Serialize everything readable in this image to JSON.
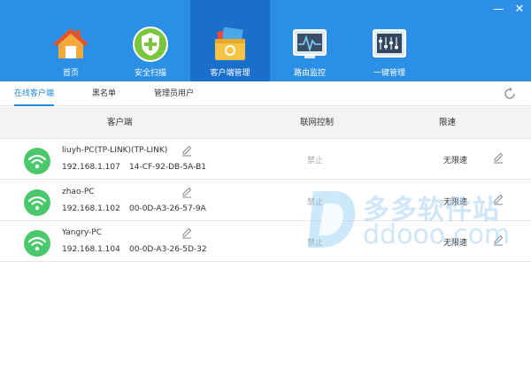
{
  "nav": {
    "items": [
      {
        "label": "首页",
        "icon": "home-icon"
      },
      {
        "label": "安全扫描",
        "icon": "shield-icon"
      },
      {
        "label": "客户端管理",
        "icon": "toolbox-icon"
      },
      {
        "label": "路由监控",
        "icon": "monitor-icon"
      },
      {
        "label": "一键管理",
        "icon": "panel-icon"
      }
    ],
    "active_index": 2
  },
  "window": {
    "minimize_label": "—",
    "close_label": "✕"
  },
  "tabs": [
    {
      "label": "在线客户端",
      "active": true
    },
    {
      "label": "黑名单",
      "active": false
    },
    {
      "label": "管理员用户",
      "active": false
    }
  ],
  "table": {
    "headers": {
      "client": "客户端",
      "network_control": "联网控制",
      "speed_limit": "限速"
    },
    "rows": [
      {
        "name": "liuyh-PC(TP-LINK)(TP-LINK)",
        "ip": "192.168.1.107",
        "mac": "14-CF-92-DB-5A-B1",
        "block_label": "禁止",
        "limit": "无限速"
      },
      {
        "name": "zhao-PC",
        "ip": "192.168.1.102",
        "mac": "00-0D-A3-26-57-9A",
        "block_label": "禁止",
        "limit": "无限速"
      },
      {
        "name": "Yangry-PC",
        "ip": "192.168.1.104",
        "mac": "00-0D-A3-26-5D-32",
        "block_label": "禁止",
        "limit": "无限速"
      }
    ]
  },
  "watermark": {
    "cn": "多多软件站",
    "en": "ddooo.com"
  },
  "colors": {
    "topbar": "#2b8fe6",
    "active_nav": "#1a6fcd",
    "accent": "#1f87e0",
    "wifi": "#4cc86c"
  }
}
